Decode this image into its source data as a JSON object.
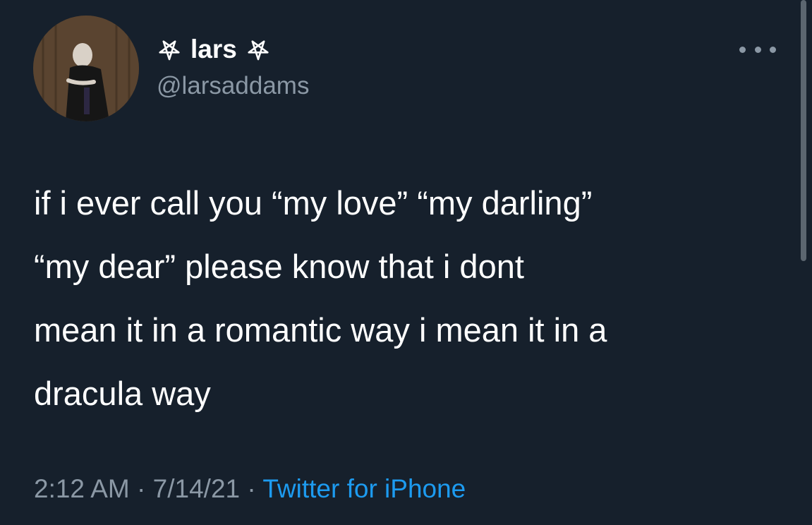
{
  "tweet": {
    "display_name": "lars",
    "handle": "@larsaddams",
    "body_lines": [
      "if i ever call you “my love” “my darling”",
      "“my dear” please know that i dont",
      "mean it in a romantic way i mean it in a",
      "dracula way"
    ],
    "time": "2:12 AM",
    "separator": "·",
    "date": "7/14/21",
    "source": "Twitter for iPhone"
  },
  "icons": {
    "name_decoration": "pentagram-icon",
    "menu": "more-options-icon"
  },
  "colors": {
    "background": "#16202c",
    "text": "#ffffff",
    "secondary_text": "#8b98a5",
    "link": "#1d9bf0"
  }
}
